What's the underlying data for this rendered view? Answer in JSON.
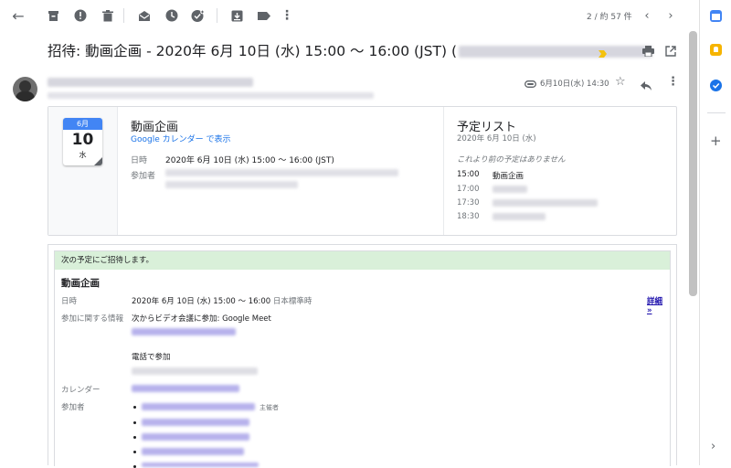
{
  "toolbar": {
    "icons": [
      "back-arrow-icon",
      "archive-icon",
      "report-spam-icon",
      "delete-icon",
      "mark-unread-icon",
      "snooze-icon",
      "add-to-tasks-icon",
      "move-to-icon",
      "label-icon",
      "more-vert-icon"
    ],
    "pager": "2 / 約 57 件"
  },
  "message": {
    "subject": "招待: 動画企画 - 2020年 6月 10日 (水) 15:00 〜 16:00 (JST) (",
    "date": "6月10日(水) 14:30"
  },
  "event_card": {
    "cal_month": "6月",
    "cal_day": "10",
    "cal_weekday": "水",
    "title": "動画企画",
    "calendar_link": "Google カレンダー で表示",
    "when_label": "日時",
    "when_value": "2020年 6月 10日 (水) 15:00 〜 16:00 (JST)",
    "guests_label": "参加者",
    "agenda_title": "予定リスト",
    "agenda_date": "2020年 6月 10日 (水)",
    "agenda_note": "これより前の予定はありません",
    "agenda": [
      {
        "time": "15:00",
        "title": "動画企画"
      },
      {
        "time": "17:00",
        "title": ""
      },
      {
        "time": "17:30",
        "title": ""
      },
      {
        "time": "18:30",
        "title": ""
      }
    ]
  },
  "invite": {
    "banner": "次の予定にご招待します。",
    "title": "動画企画",
    "when_label": "日時",
    "when_value": "2020年 6月 10日 (水) 15:00 〜 16:00",
    "when_tz": "日本標準時",
    "details_link": "詳細 »",
    "join_label": "参加に関する情報",
    "join_value": "次からビデオ会議に参加: Google Meet",
    "phone_label": "電話で参加",
    "calendar_label": "カレンダー",
    "guests_label": "参加者",
    "organizer": "主催者"
  },
  "colors": {
    "accent": "#4285f4",
    "link": "#1a0dab",
    "banner": "#d9f0d9",
    "calendar_blue": "#1a73e8"
  }
}
